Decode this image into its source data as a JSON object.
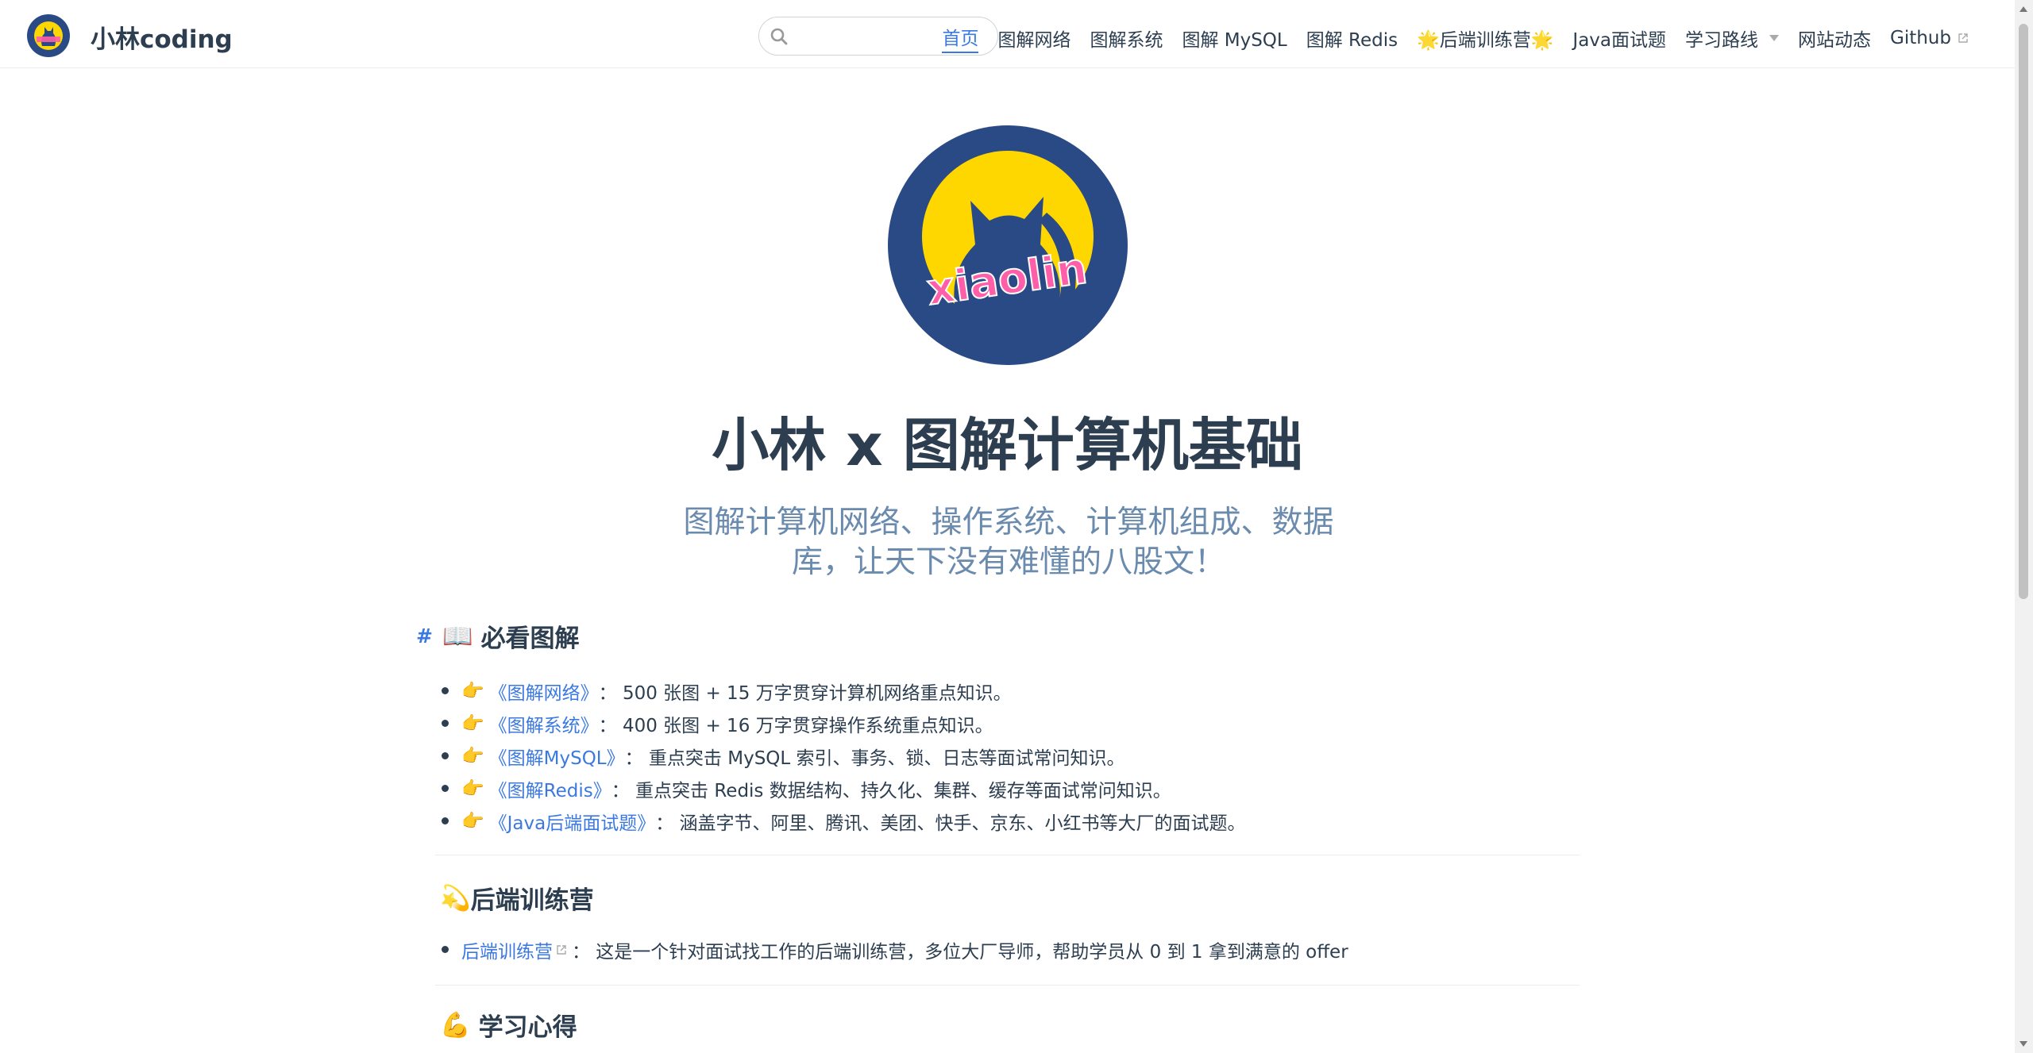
{
  "nav": {
    "site_name": "小林coding",
    "links": [
      {
        "label": "首页"
      },
      {
        "label": "图解网络"
      },
      {
        "label": "图解系统"
      },
      {
        "label": "图解 MySQL"
      },
      {
        "label": "图解 Redis"
      },
      {
        "label": "🌟后端训练营🌟"
      },
      {
        "label": "Java面试题"
      },
      {
        "label": "学习路线"
      },
      {
        "label": "网站动态"
      },
      {
        "label": "Github"
      }
    ]
  },
  "hero": {
    "logo_text": "xiaolin",
    "title": "小林 x 图解计算机基础",
    "description": "图解计算机网络、操作系统、计算机组成、数据库，让天下没有难懂的八股文！"
  },
  "sections": {
    "must_read": {
      "anchor": "#",
      "emoji": "📖",
      "title": "必看图解",
      "items": [
        {
          "hand": "👉",
          "link": "《图解网络》",
          "text": "： 500 张图 + 15 万字贯穿计算机网络重点知识。"
        },
        {
          "hand": "👉",
          "link": "《图解系统》",
          "text": "： 400 张图 + 16 万字贯穿操作系统重点知识。"
        },
        {
          "hand": "👉",
          "link": "《图解MySQL》",
          "text": "： 重点突击 MySQL 索引、事务、锁、日志等面试常问知识。"
        },
        {
          "hand": "👉",
          "link": "《图解Redis》",
          "text": "： 重点突击 Redis 数据结构、持久化、集群、缓存等面试常问知识。"
        },
        {
          "hand": "👉",
          "link": "《Java后端面试题》",
          "text": "： 涵盖字节、阿里、腾讯、美团、快手、京东、小红书等大厂的面试题。"
        }
      ]
    },
    "bootcamp": {
      "emoji": "💫",
      "title": "后端训练营",
      "items": [
        {
          "link": "后端训练营",
          "text": "： 这是一个针对面试找工作的后端训练营，多位大厂导师，帮助学员从 0 到 1 拿到满意的 offer"
        }
      ]
    },
    "study": {
      "emoji": "💪",
      "title": "学习心得"
    }
  },
  "colors": {
    "accent": "#3b79e0",
    "text": "#2c3e50",
    "subtitle": "#6a8bad",
    "logo_bg": "#2a4a86",
    "logo_yellow": "#ffd700",
    "logo_pink": "#ff5fa8"
  }
}
